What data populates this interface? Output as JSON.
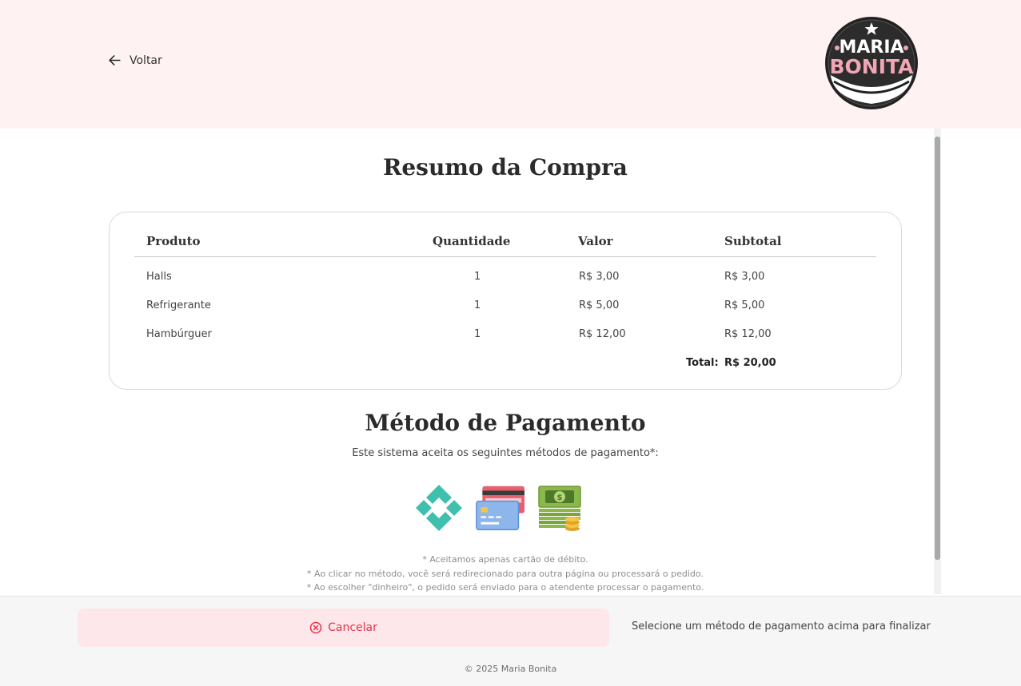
{
  "header": {
    "back_label": "Voltar",
    "logo_text_line1": "MARIA",
    "logo_text_line2": "BONITA"
  },
  "summary": {
    "title": "Resumo da Compra",
    "columns": [
      "Produto",
      "Quantidade",
      "Valor",
      "Subtotal"
    ],
    "rows": [
      {
        "produto": "Halls",
        "quantidade": "1",
        "valor": "R$ 3,00",
        "subtotal": "R$ 3,00"
      },
      {
        "produto": "Refrigerante",
        "quantidade": "1",
        "valor": "R$ 5,00",
        "subtotal": "R$ 5,00"
      },
      {
        "produto": "Hambúrguer",
        "quantidade": "1",
        "valor": "R$ 12,00",
        "subtotal": "R$ 12,00"
      }
    ],
    "total_label": "Total:",
    "total_value": "R$ 20,00"
  },
  "payment": {
    "title": "Método de Pagamento",
    "subtitle": "Este sistema aceita os seguintes métodos de pagamento*:",
    "methods": [
      {
        "icon": "pix-icon"
      },
      {
        "icon": "credit-card-icon"
      },
      {
        "icon": "cash-icon"
      }
    ],
    "notes": [
      "* Aceitamos apenas cartão de débito.",
      "* Ao clicar no método, você será redirecionado para outra página ou processará o pedido.",
      "* Ao escolher \"dinheiro\", o pedido será enviado para o atendente processar o pagamento."
    ]
  },
  "footer": {
    "cancel_label": "Cancelar",
    "hint": "Selecione um método de pagamento acima para finalizar",
    "copyright": "© 2025 Maria Bonita"
  },
  "colors": {
    "header_bg": "#fff2f3",
    "cancel_bg": "#fde7ea",
    "cancel_text": "#e5334a",
    "pix": "#3fbfad",
    "logo_pink": "#f2a5b4"
  }
}
